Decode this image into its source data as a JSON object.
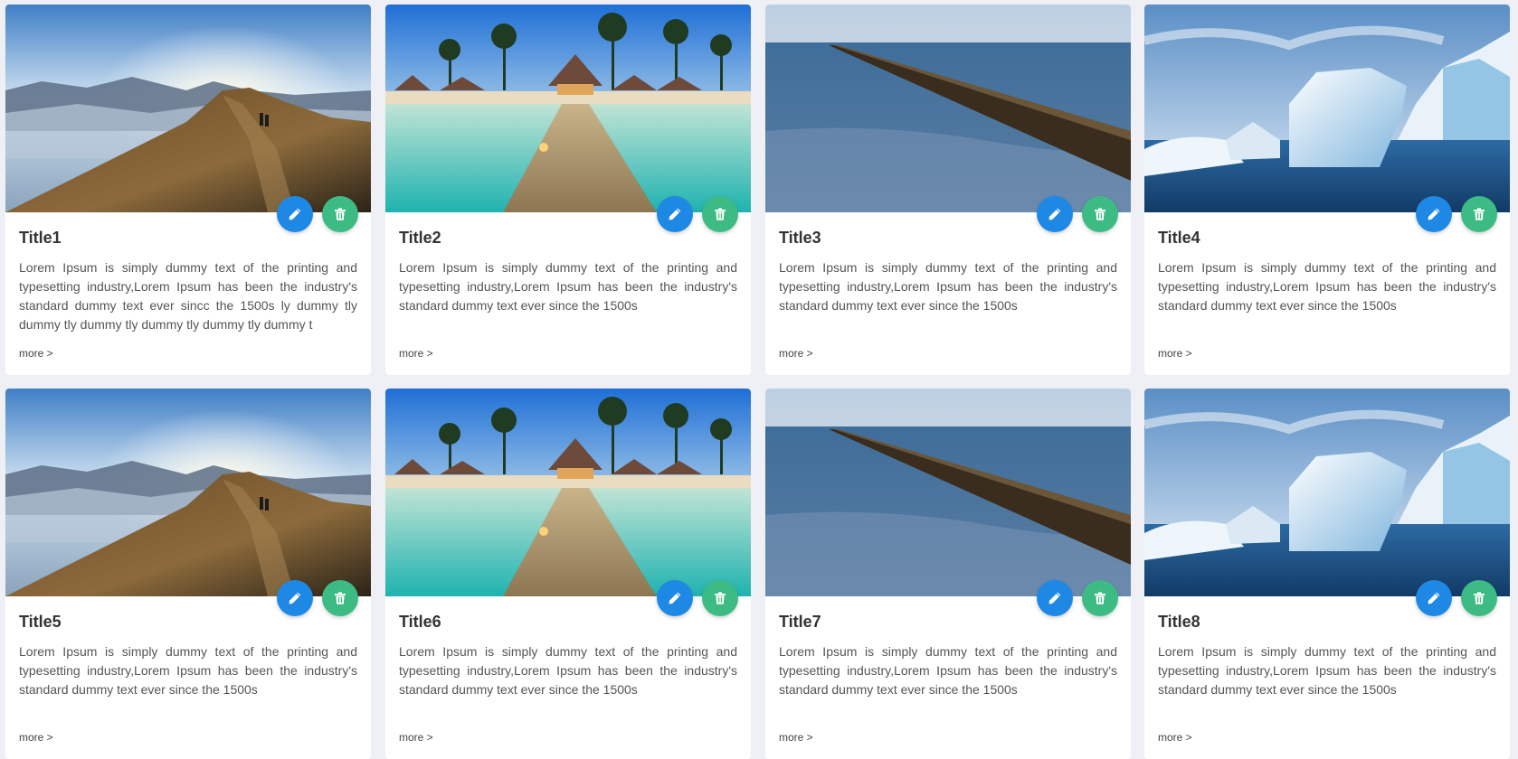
{
  "cards": [
    {
      "title": "Title1",
      "desc": "Lorem Ipsum is simply dummy text of the printing and typesetting industry,Lorem Ipsum has been the industry's standard dummy text ever sincc the 1500s ly dummy tly dummy tly dummy tly dummy tly dummy tly dummy t",
      "more": "more >",
      "image": "mountain-hiker-image"
    },
    {
      "title": "Title2",
      "desc": "Lorem Ipsum is simply dummy text of the printing and typesetting industry,Lorem Ipsum has been the industry's standard dummy text ever since the 1500s",
      "more": "more >",
      "image": "beach-resort-pier-image"
    },
    {
      "title": "Title3",
      "desc": "Lorem Ipsum is simply dummy text of the printing and typesetting industry,Lorem Ipsum has been the industry's standard dummy text ever since the 1500s",
      "more": "more >",
      "image": "sea-groyne-image"
    },
    {
      "title": "Title4",
      "desc": "Lorem Ipsum is simply dummy text of the printing and typesetting industry,Lorem Ipsum has been the industry's standard dummy text ever since the 1500s",
      "more": "more >",
      "image": "iceberg-image"
    },
    {
      "title": "Title5",
      "desc": "Lorem Ipsum is simply dummy text of the printing and typesetting industry,Lorem Ipsum has been the industry's standard dummy text ever since the 1500s",
      "more": "more >",
      "image": "mountain-hiker-image"
    },
    {
      "title": "Title6",
      "desc": "Lorem Ipsum is simply dummy text of the printing and typesetting industry,Lorem Ipsum has been the industry's standard dummy text ever since the 1500s",
      "more": "more >",
      "image": "beach-resort-pier-image"
    },
    {
      "title": "Title7",
      "desc": "Lorem Ipsum is simply dummy text of the printing and typesetting industry,Lorem Ipsum has been the industry's standard dummy text ever since the 1500s",
      "more": "more >",
      "image": "sea-groyne-image"
    },
    {
      "title": "Title8",
      "desc": "Lorem Ipsum is simply dummy text of the printing and typesetting industry,Lorem Ipsum has been the industry's standard dummy text ever since the 1500s",
      "more": "more >",
      "image": "iceberg-image"
    }
  ],
  "icons": {
    "edit": "pencil-icon",
    "delete": "trash-icon"
  },
  "colors": {
    "edit_button": "#1e88e5",
    "delete_button": "#3dbb84",
    "background": "#eef0f5"
  }
}
